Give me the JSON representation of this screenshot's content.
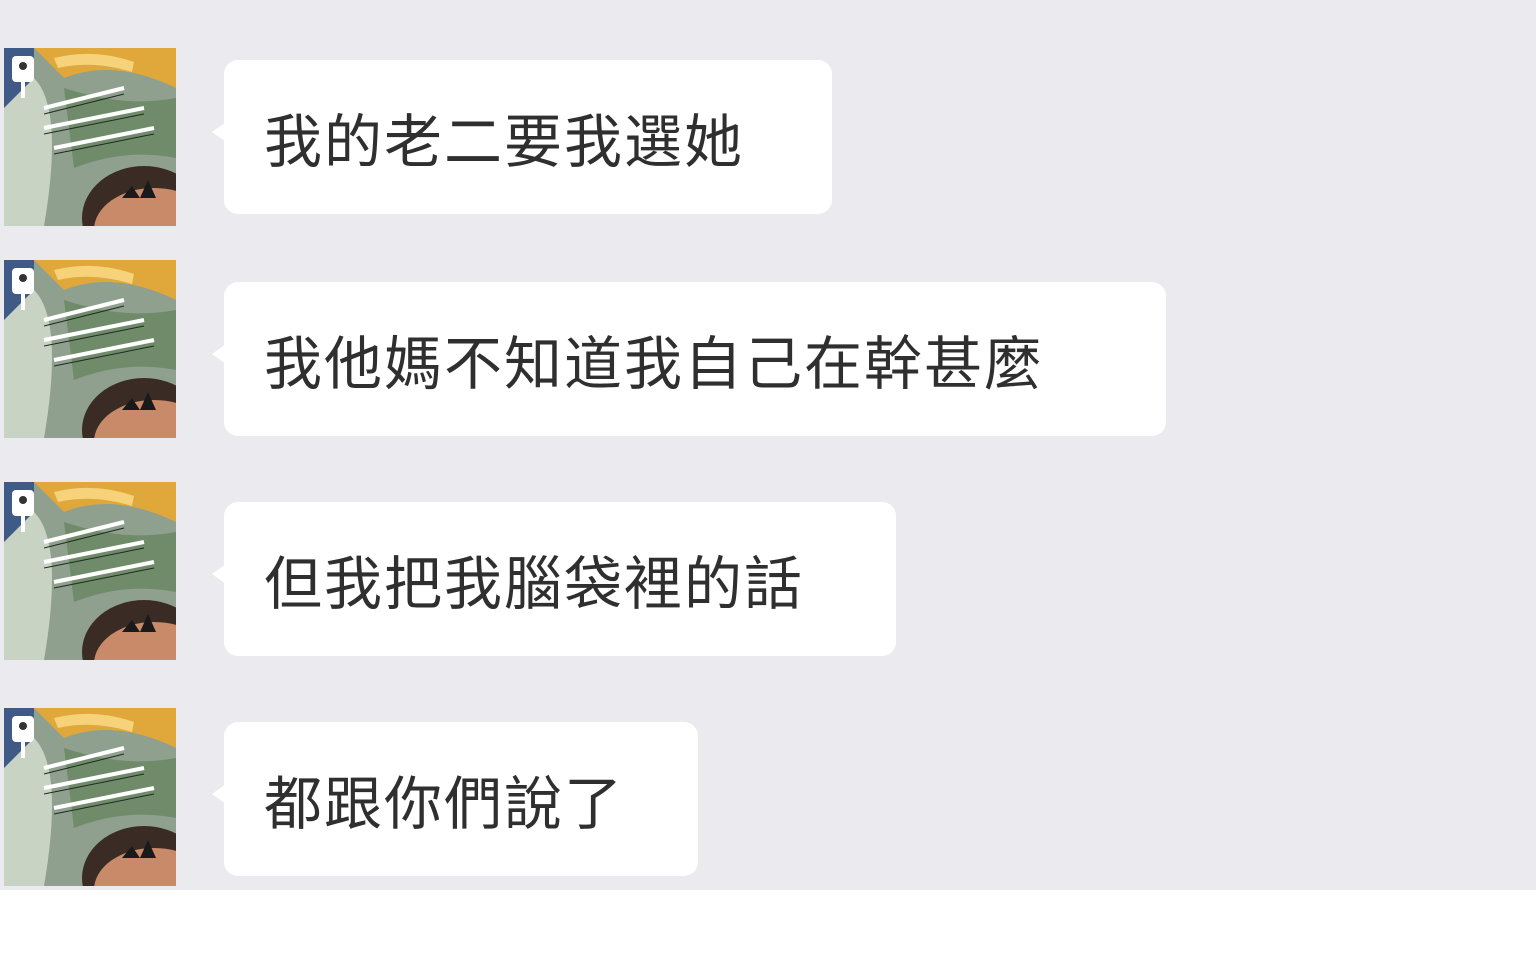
{
  "chat": {
    "messages": [
      {
        "text": "我的老二要我選她",
        "avatar_icon": "user-avatar-comic-icon"
      },
      {
        "text": "我他媽不知道我自己在幹甚麼",
        "avatar_icon": "user-avatar-comic-icon"
      },
      {
        "text": "但我把我腦袋裡的話",
        "avatar_icon": "user-avatar-comic-icon"
      },
      {
        "text": "都跟你們說了",
        "avatar_icon": "user-avatar-comic-icon"
      }
    ]
  },
  "colors": {
    "chat_background": "#ebeaee",
    "bubble_background": "#ffffff",
    "text": "#2f2f2f",
    "page_background": "#ffffff"
  }
}
